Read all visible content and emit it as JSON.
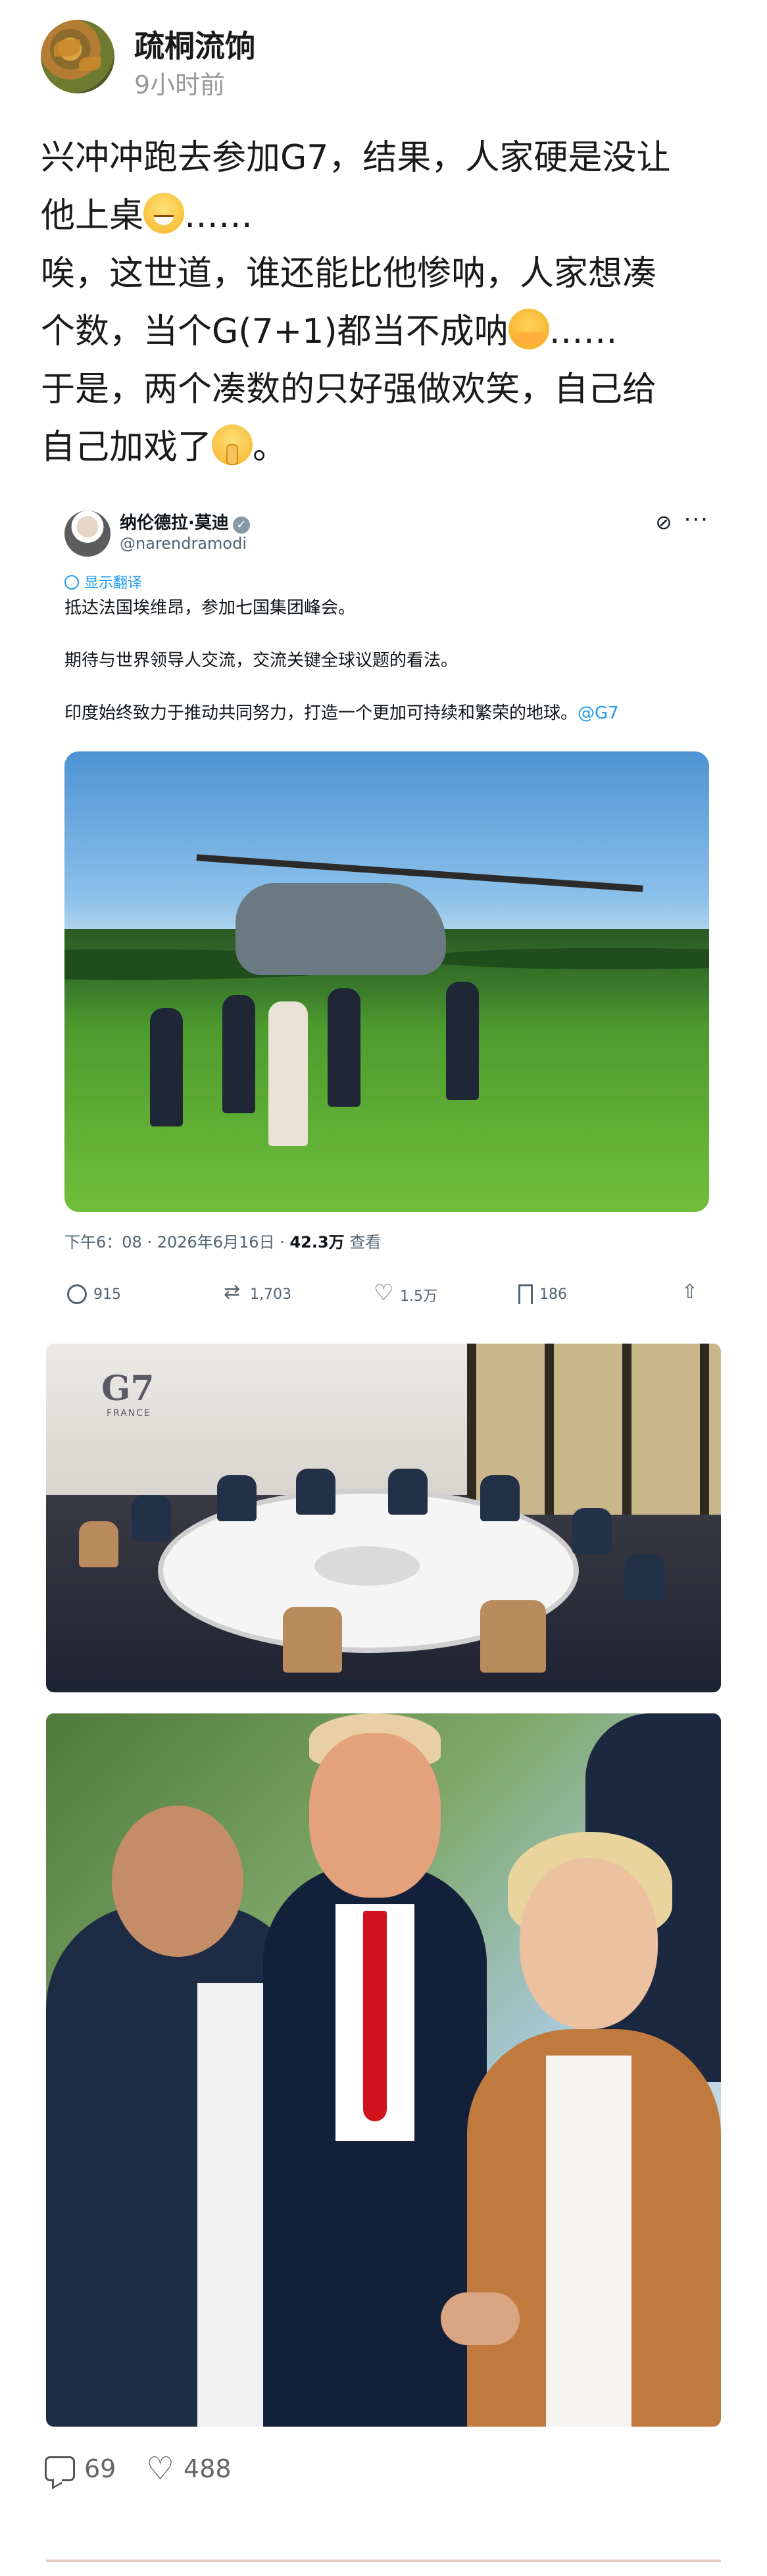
{
  "post": {
    "author": "疏桐流饷",
    "time": "9小时前",
    "lines": [
      "兴冲冲跑去参加G7，结果，人家硬是没让",
      "他上桌",
      "……",
      "唉，这世道，谁还能比他惨呐，人家想凑",
      "个数，当个G(7+1)都当不成呐",
      "……",
      "于是，两个凑数的只好强做欢笑，自己给",
      "自己加戏了",
      "。"
    ],
    "emojis": [
      "grin-face-icon",
      "hug-face-icon",
      "shushing-face-icon"
    ]
  },
  "tweet": {
    "name": "纳伦德拉·莫迪",
    "handle": "@narendramodi",
    "translate": "显示翻译",
    "body": [
      "抵达法国埃维昂，参加七国集团峰会。",
      "期待与世界领导人交流，交流关键全球议题的看法。",
      "印度始终致力于推动共同努力，打造一个更加可持续和繁荣的地球。"
    ],
    "hashtag": "@G7",
    "meta_time": "下午6：08 · 2026年6月16日 · ",
    "meta_views": "42.3万",
    "meta_views_suffix": " 查看",
    "actions": {
      "replies": "915",
      "retweets": "1,703",
      "likes": "1.5万",
      "bookmarks": "186"
    }
  },
  "photos": {
    "g7_logo": "G7",
    "g7_logo_sub": "FRANCE"
  },
  "footer": {
    "comments": "69",
    "likes": "488"
  },
  "colors": {
    "link": "#1d9bf0",
    "muted": "#999999",
    "tie": "#d0131d"
  }
}
